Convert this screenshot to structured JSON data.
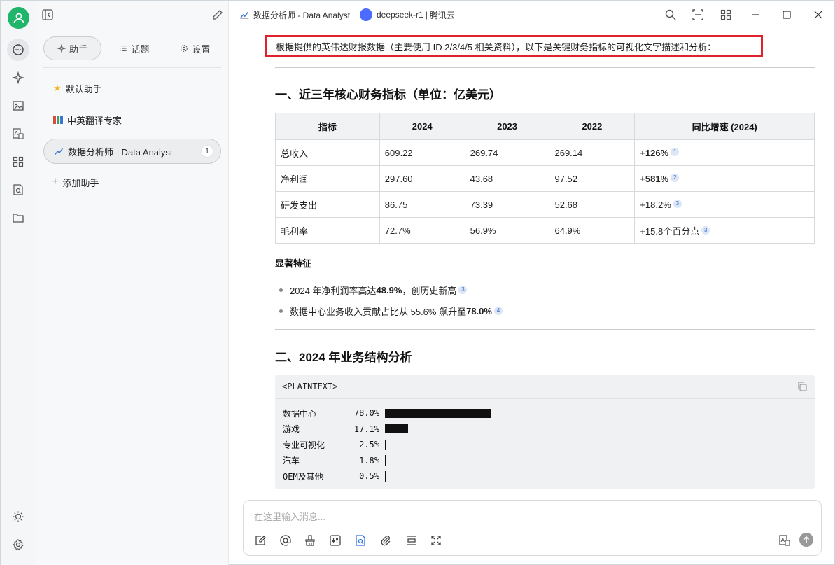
{
  "titlebar": {
    "assistant_title": "数据分析师 - Data Analyst",
    "model_name": "deepseek-r1",
    "provider": "腾讯云",
    "model_sep": "|"
  },
  "sidebar": {
    "tabs": [
      {
        "label": "助手",
        "icon": "sparkle-icon",
        "active": true
      },
      {
        "label": "话题",
        "icon": "list-icon",
        "active": false
      },
      {
        "label": "设置",
        "icon": "gear-icon",
        "active": false
      }
    ],
    "assistants": [
      {
        "label": "默认助手",
        "icon": "star-icon"
      },
      {
        "label": "中英翻译专家",
        "icon": "books-icon"
      },
      {
        "label": "数据分析师 - Data Analyst",
        "icon": "chart-icon",
        "count": "1",
        "active": true
      }
    ],
    "add_label": "添加助手"
  },
  "message": {
    "intro": "根据提供的英伟达财报数据（主要使用 ID 2/3/4/5 相关资料），以下是关键财务指标的可视化文字描述和分析：",
    "section1_title": "一、近三年核心财务指标（单位：亿美元）",
    "table": {
      "headers": [
        "指标",
        "2024",
        "2023",
        "2022",
        "同比增速 (2024)"
      ],
      "rows": [
        {
          "metric": "总收入",
          "y2024": "609.22",
          "y2023": "269.74",
          "y2022": "269.14",
          "growth": "+126%",
          "bold": true,
          "ref": "1"
        },
        {
          "metric": "净利润",
          "y2024": "297.60",
          "y2023": "43.68",
          "y2022": "97.52",
          "growth": "+581%",
          "bold": true,
          "ref": "2"
        },
        {
          "metric": "研发支出",
          "y2024": "86.75",
          "y2023": "73.39",
          "y2022": "52.68",
          "growth": "+18.2%",
          "bold": false,
          "ref": "3"
        },
        {
          "metric": "毛利率",
          "y2024": "72.7%",
          "y2023": "56.9%",
          "y2022": "64.9%",
          "growth": "+15.8个百分点",
          "bold": false,
          "ref": "3"
        }
      ]
    },
    "features_title": "显著特征",
    "bullets": [
      {
        "pre": "2024 年净利润率高达 ",
        "bold": "48.9%",
        "post": "，创历史新高",
        "ref": "3"
      },
      {
        "pre": "数据中心业务收入贡献占比从 55.6% 飙升至 ",
        "bold": "78.0%",
        "post": "",
        "ref": "4"
      }
    ],
    "section2_title": "二、2024 年业务结构分析",
    "code": {
      "lang": "<PLAINTEXT>",
      "lines": [
        {
          "label": "数据中心",
          "pct": "78.0%",
          "value": 78.0
        },
        {
          "label": "游戏",
          "pct": "17.1%",
          "value": 17.1
        },
        {
          "label": "专业可视化",
          "pct": "2.5%",
          "value": 2.5
        },
        {
          "label": "汽车",
          "pct": "1.8%",
          "value": 1.8
        },
        {
          "label": "OEM及其他",
          "pct": "0.5%",
          "value": 0.5
        }
      ]
    }
  },
  "input": {
    "placeholder": "在这里输入消息..."
  }
}
